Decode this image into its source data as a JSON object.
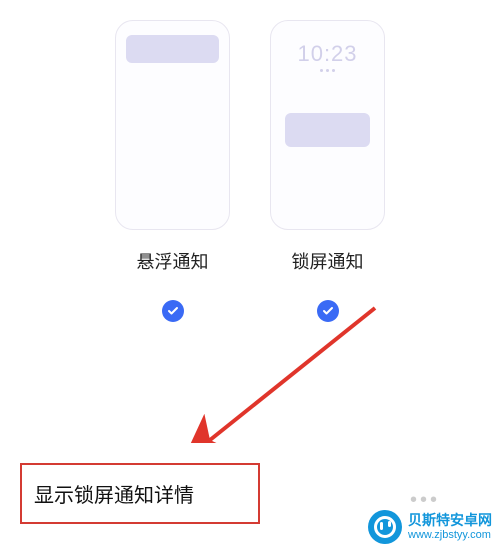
{
  "options": {
    "floating": {
      "label": "悬浮通知"
    },
    "lockscreen": {
      "label": "锁屏通知",
      "preview_time": "10:23"
    }
  },
  "setting": {
    "label": "显示锁屏通知详情"
  },
  "watermark": {
    "title": "贝斯特安卓网",
    "url": "www.zjbstyy.com"
  },
  "colors": {
    "accent": "#3a6af5",
    "highlight_border": "#d43b33",
    "arrow": "#e0352b",
    "brand": "#1296db"
  }
}
